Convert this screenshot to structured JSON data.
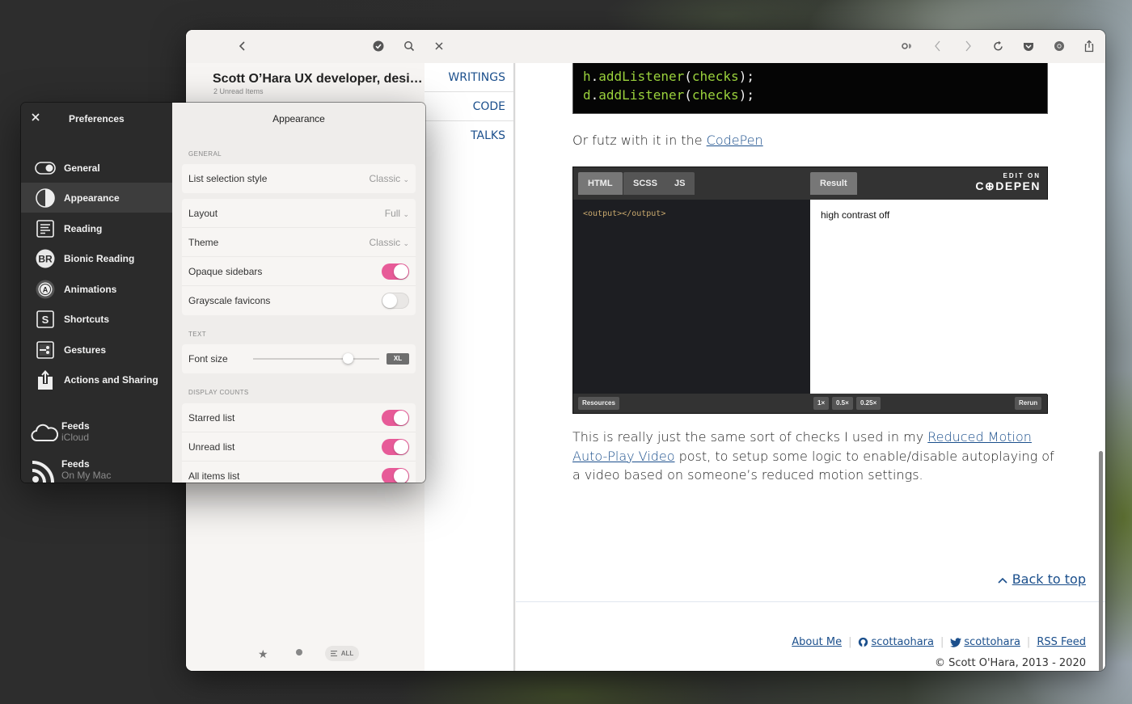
{
  "toolbar": {
    "left_icons": [
      "chevron-left-icon",
      "mark-read-icon",
      "search-icon",
      "close-icon"
    ],
    "right_icons": [
      "reader-toggle-icon",
      "back-icon",
      "forward-icon",
      "reload-icon",
      "pocket-icon",
      "chrome-icon",
      "share-icon"
    ]
  },
  "feed": {
    "title": "Scott O’Hara UX developer, desi…",
    "subtitle": "2 Unread Items",
    "filters": {
      "starred_icon": "★",
      "unread_icon": "●",
      "all_label": "ALL"
    }
  },
  "site_nav": {
    "items": [
      "WRITINGS",
      "CODE",
      "TALKS"
    ]
  },
  "article": {
    "code_lines": [
      {
        "obj": "h",
        "method": "addListener",
        "arg": "checks"
      },
      {
        "obj": "d",
        "method": "addListener",
        "arg": "checks"
      }
    ],
    "futz_text": "Or futz with it in the ",
    "futz_link": "CodePen",
    "codepen": {
      "tabs": [
        "HTML",
        "SCSS",
        "JS"
      ],
      "active_tab": "HTML",
      "result_tab": "Result",
      "logo_small": "EDIT ON",
      "logo_big": "C⊕DEPEN",
      "code": "<output></output>",
      "result_text": "high contrast off",
      "resources_label": "Resources",
      "zoom_options": [
        "1×",
        "0.5×",
        "0.25×"
      ],
      "rerun_label": "Rerun"
    },
    "para_before": "This is really just the same sort of checks I used in my ",
    "para_link": "Reduced Motion Auto-Play Video",
    "para_after": " post, to setup some logic to enable/disable autoplaying of a video based on someone’s reduced motion settings.",
    "back_to_top": "Back to top",
    "footer_links": [
      "About Me",
      "scottaohara",
      "scottohara",
      "RSS Feed"
    ],
    "copyright": "© Scott O'Hara, 2013 - 2020"
  },
  "prefs": {
    "title": "Preferences",
    "sidebar": [
      {
        "label": "General",
        "icon": "toggle-icon"
      },
      {
        "label": "Appearance",
        "icon": "half-circle-icon",
        "active": true
      },
      {
        "label": "Reading",
        "icon": "reading-icon"
      },
      {
        "label": "Bionic Reading",
        "icon": "br-icon"
      },
      {
        "label": "Animations",
        "icon": "animations-icon"
      },
      {
        "label": "Shortcuts",
        "icon": "shortcuts-icon"
      },
      {
        "label": "Gestures",
        "icon": "gestures-icon"
      },
      {
        "label": "Actions and Sharing",
        "icon": "share-icon"
      }
    ],
    "accounts": [
      {
        "name": "Feeds",
        "location": "iCloud",
        "icon": "cloud-icon"
      },
      {
        "name": "Feeds",
        "location": "On My Mac",
        "icon": "rss-icon"
      }
    ],
    "panel_title": "Appearance",
    "sections": {
      "general_label": "GENERAL",
      "text_label": "TEXT",
      "display_counts_label": "DISPLAY COUNTS"
    },
    "list_selection_style": {
      "label": "List selection style",
      "value": "Classic"
    },
    "layout": {
      "label": "Layout",
      "value": "Full"
    },
    "theme": {
      "label": "Theme",
      "value": "Classic"
    },
    "opaque_sidebars": {
      "label": "Opaque sidebars",
      "on": true
    },
    "grayscale_favicons": {
      "label": "Grayscale favicons",
      "on": false
    },
    "font_size": {
      "label": "Font size",
      "value": "XL",
      "slider_fraction": 0.75
    },
    "starred_list": {
      "label": "Starred list",
      "on": true
    },
    "unread_list": {
      "label": "Unread list",
      "on": true
    },
    "all_items_list": {
      "label": "All items list",
      "on": true
    },
    "accent_color": "#e75b98"
  }
}
